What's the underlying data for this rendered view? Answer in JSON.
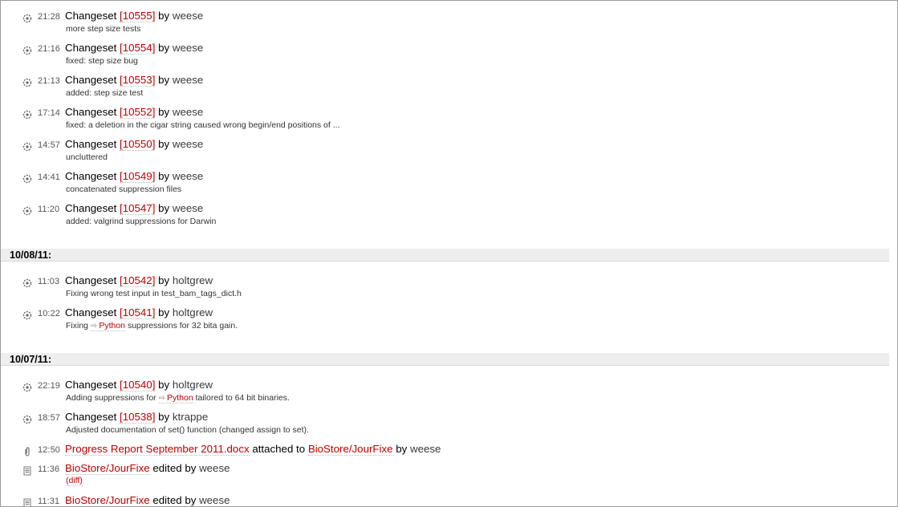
{
  "entries_top": [
    {
      "time": "21:28",
      "kind": "Changeset",
      "id": "[10555]",
      "by": "by",
      "author": "weese",
      "msg": "more step size tests"
    },
    {
      "time": "21:16",
      "kind": "Changeset",
      "id": "[10554]",
      "by": "by",
      "author": "weese",
      "msg": "fixed: step size bug"
    },
    {
      "time": "21:13",
      "kind": "Changeset",
      "id": "[10553]",
      "by": "by",
      "author": "weese",
      "msg": "added: step size test"
    },
    {
      "time": "17:14",
      "kind": "Changeset",
      "id": "[10552]",
      "by": "by",
      "author": "weese",
      "msg": "fixed: a deletion in the cigar string caused wrong begin/end positions of ..."
    },
    {
      "time": "14:57",
      "kind": "Changeset",
      "id": "[10550]",
      "by": "by",
      "author": "weese",
      "msg": "uncluttered"
    },
    {
      "time": "14:41",
      "kind": "Changeset",
      "id": "[10549]",
      "by": "by",
      "author": "weese",
      "msg": "concatenated suppression files"
    },
    {
      "time": "11:20",
      "kind": "Changeset",
      "id": "[10547]",
      "by": "by",
      "author": "weese",
      "msg": "added: valgrind suppressions for Darwin"
    }
  ],
  "day1": {
    "header": "10/08/11:",
    "entries": [
      {
        "time": "11:03",
        "kind": "Changeset",
        "id": "[10542]",
        "by": "by",
        "author": "holtgrew",
        "msg": "Fixing wrong test input in test_bam_tags_dict.h"
      },
      {
        "time": "10:22",
        "kind": "Changeset",
        "id": "[10541]",
        "by": "by",
        "author": "holtgrew",
        "msg_pre": "Fixing",
        "msg_link": "Python",
        "msg_post": "suppressions for 32 bita gain."
      }
    ]
  },
  "day2": {
    "header": "10/07/11:",
    "entries": [
      {
        "time": "22:19",
        "kind": "Changeset",
        "id": "[10540]",
        "by": "by",
        "author": "holtgrew",
        "msg_pre": "Adding suppressions for",
        "msg_link": "Python",
        "msg_post": "tailored to 64 bit binaries."
      },
      {
        "time": "18:57",
        "kind": "Changeset",
        "id": "[10538]",
        "by": "by",
        "author": "ktrappe",
        "msg": "Adjusted documentation of set() function (changed assign to set)."
      }
    ],
    "attachment": {
      "time": "12:50",
      "file": "Progress Report September 2011.docx",
      "attached_to": "attached to",
      "page": "BioStore/JourFixe",
      "by": "by",
      "author": "weese"
    },
    "wiki_edits": [
      {
        "time": "11:36",
        "page": "BioStore/JourFixe",
        "edited": "edited by",
        "author": "weese",
        "diff": "(diff)"
      },
      {
        "time": "11:31",
        "page": "BioStore/JourFixe",
        "edited": "edited by",
        "author": "weese"
      }
    ]
  },
  "icons": {
    "changeset": "changeset-icon",
    "attachment": "paperclip-icon",
    "wiki": "wiki-page-icon",
    "wiki_link": "wiki-link-arrow-icon"
  },
  "colors": {
    "link": "#bb0000",
    "header_bg": "#eeeeee",
    "author": "#3a3a3a"
  }
}
